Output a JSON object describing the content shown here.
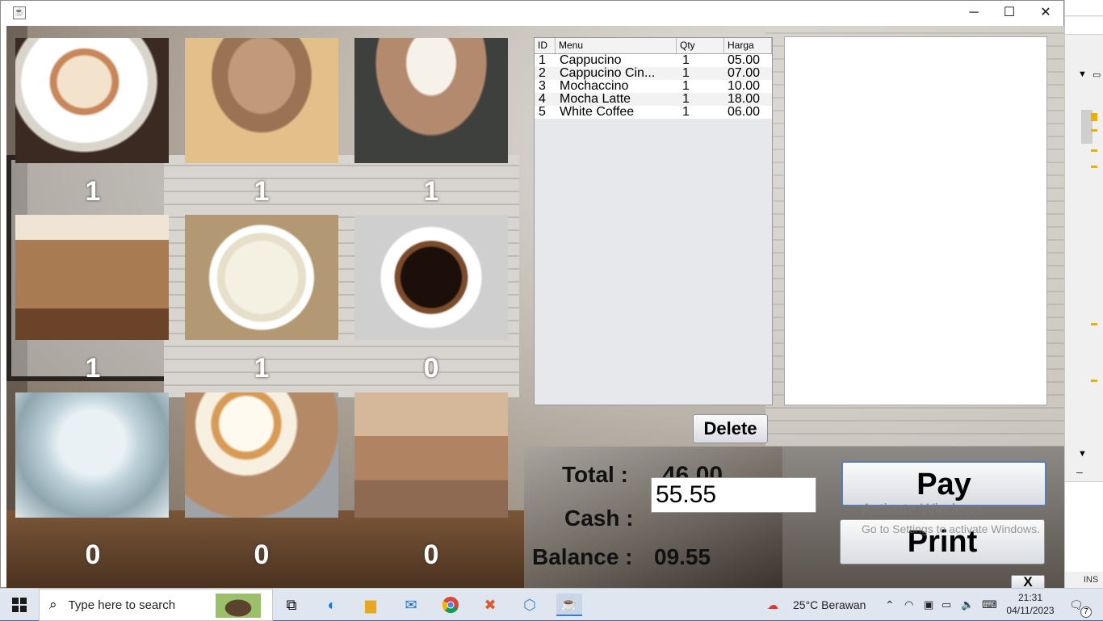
{
  "window": {
    "controls": {
      "minimize": "─",
      "maximize": "☐",
      "close": "✕"
    }
  },
  "menu_counts": [
    "1",
    "1",
    "1",
    "1",
    "1",
    "0",
    "0",
    "0",
    "0"
  ],
  "order_table": {
    "headers": [
      "ID",
      "Menu",
      "Qty",
      "Harga"
    ],
    "rows": [
      {
        "id": "1",
        "menu": "Cappucino",
        "qty": "1",
        "harga": "05.00"
      },
      {
        "id": "2",
        "menu": "Cappucino Cin...",
        "qty": "1",
        "harga": "07.00"
      },
      {
        "id": "3",
        "menu": "Mochaccino",
        "qty": "1",
        "harga": "10.00"
      },
      {
        "id": "4",
        "menu": "Mocha Latte",
        "qty": "1",
        "harga": "18.00"
      },
      {
        "id": "5",
        "menu": "White Coffee",
        "qty": "1",
        "harga": "06.00"
      }
    ]
  },
  "buttons": {
    "delete": "Delete",
    "pay": "Pay",
    "print": "Print",
    "close_x": "X"
  },
  "totals": {
    "total_label": "Total :",
    "total_value": "46.00",
    "cash_label": "Cash :",
    "cash_value": "55.55",
    "balance_label": "Balance :",
    "balance_value": "09.55"
  },
  "watermark": {
    "line1": "Activate Windows",
    "line2": "Go to Settings to activate Windows."
  },
  "ide": {
    "ins": "INS"
  },
  "taskbar": {
    "search_placeholder": "Type here to search",
    "weather": "25°C  Berawan",
    "time": "21:31",
    "date": "04/11/2023",
    "notifications": "7"
  }
}
